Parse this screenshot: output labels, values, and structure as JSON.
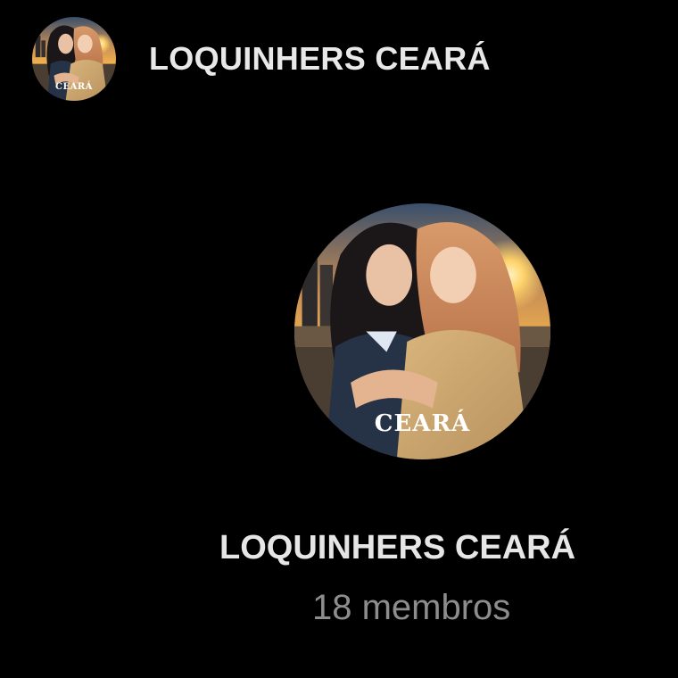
{
  "header": {
    "title": "LOQUINHERS CEARÁ",
    "avatar_icon": "group-photo-icon",
    "avatar_caption": "CEARÁ"
  },
  "profile": {
    "avatar_icon": "group-photo-icon",
    "avatar_caption": "CEARÁ",
    "name": "LOQUINHERS CEARÁ",
    "members": "18 membros"
  },
  "colors": {
    "background": "#000000",
    "title_text": "#e6e6e6",
    "secondary_text": "#8d8d8d"
  }
}
